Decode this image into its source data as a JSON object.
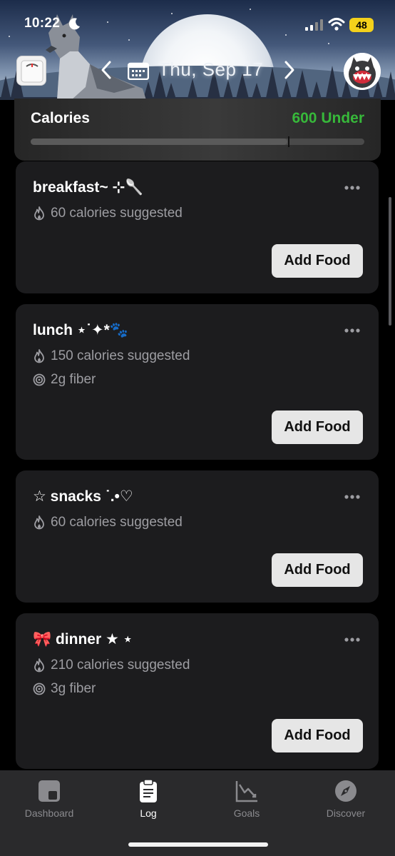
{
  "status_bar": {
    "time": "10:22",
    "battery": "48"
  },
  "header": {
    "date_label": "Thu, Sep 17"
  },
  "calories": {
    "title": "Calories",
    "status": "600 Under",
    "progress_fraction": 0.77
  },
  "meals": [
    {
      "title": "breakfast~ ⊹🥄",
      "rows": [
        {
          "icon": "flame-icon",
          "text": "60 calories suggested"
        }
      ],
      "button": "Add Food"
    },
    {
      "title": "lunch ⋆˙✦*🐾",
      "rows": [
        {
          "icon": "flame-icon",
          "text": "150 calories suggested"
        },
        {
          "icon": "target-icon",
          "text": "2g fiber"
        }
      ],
      "button": "Add Food"
    },
    {
      "title": "☆  snacks ˙.•♡",
      "rows": [
        {
          "icon": "flame-icon",
          "text": "60 calories suggested"
        }
      ],
      "button": "Add Food"
    },
    {
      "title": "🎀 dinner ★  ⋆",
      "rows": [
        {
          "icon": "flame-icon",
          "text": "210 calories suggested"
        },
        {
          "icon": "target-icon",
          "text": "3g fiber"
        }
      ],
      "button": "Add Food"
    }
  ],
  "tabbar": {
    "tabs": [
      {
        "label": "Dashboard",
        "icon": "dashboard-icon",
        "active": false
      },
      {
        "label": "Log",
        "icon": "clipboard-icon",
        "active": true
      },
      {
        "label": "Goals",
        "icon": "chart-icon",
        "active": false
      },
      {
        "label": "Discover",
        "icon": "compass-icon",
        "active": false
      }
    ]
  },
  "colors": {
    "under_green": "#37b83a",
    "card_bg": "#1c1c1e",
    "button_bg": "#e6e6e6",
    "battery_yellow": "#f4d11b"
  }
}
